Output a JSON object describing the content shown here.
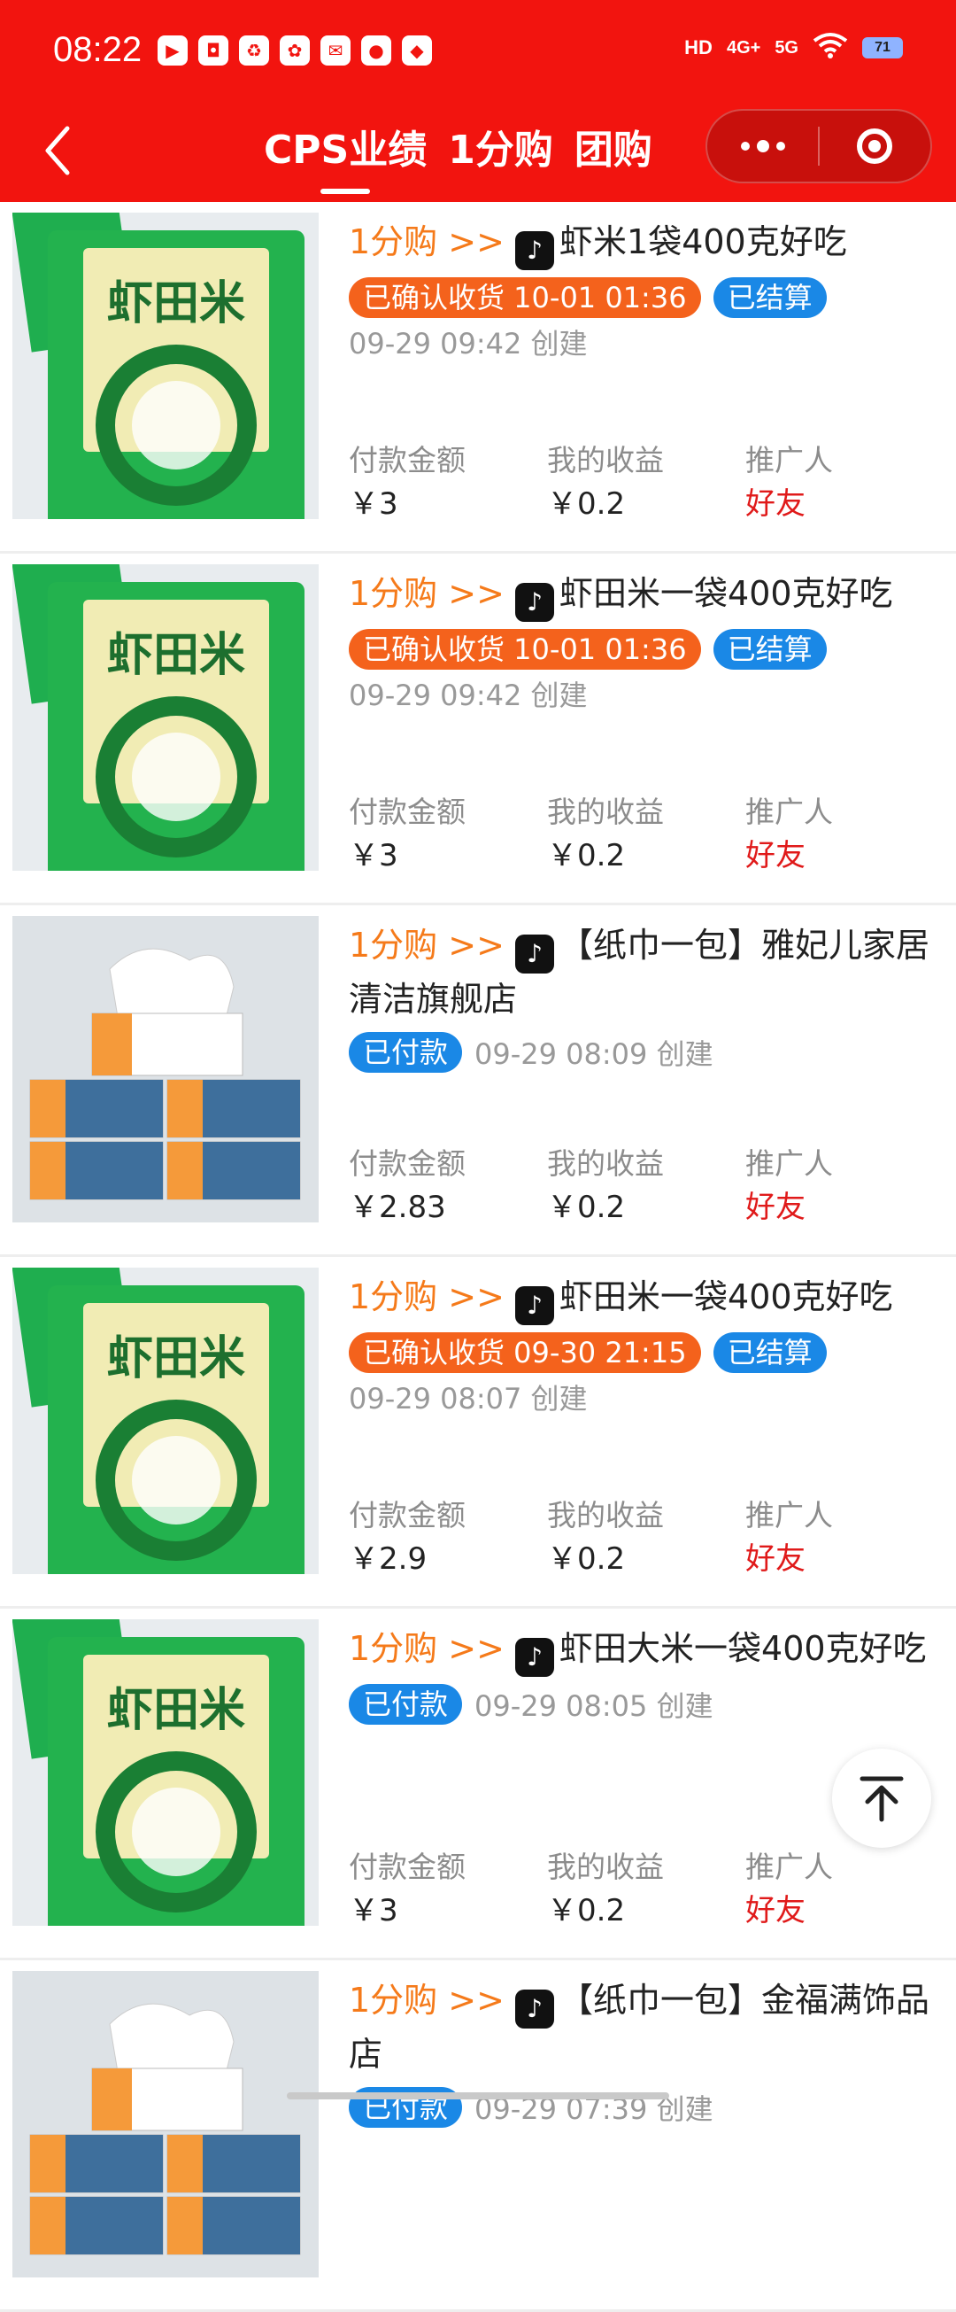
{
  "status_bar": {
    "time": "08:22",
    "network": [
      "HD",
      "4G+",
      "5G"
    ],
    "battery": "71"
  },
  "nav": {
    "tabs": [
      {
        "label": "CPS业绩",
        "active": true
      },
      {
        "label": "1分购",
        "active": false
      },
      {
        "label": "团购",
        "active": false
      }
    ]
  },
  "labels": {
    "paid": "付款金额",
    "earn": "我的收益",
    "promoter": "推广人",
    "created_suffix": "创建"
  },
  "orders": [
    {
      "prefix": "1分购 >>",
      "title": "虾米1袋400克好吃",
      "status": "已确认收货 10-01 01:36",
      "status_color": "orange",
      "settle": "已结算",
      "created": "09-29 09:42 创建",
      "paid": "￥3",
      "earn": "￥0.2",
      "promoter": "好友",
      "image": "rice-bag"
    },
    {
      "prefix": "1分购 >>",
      "title": "虾田米一袋400克好吃",
      "status": "已确认收货 10-01 01:36",
      "status_color": "orange",
      "settle": "已结算",
      "created": "09-29 09:42 创建",
      "paid": "￥3",
      "earn": "￥0.2",
      "promoter": "好友",
      "image": "rice-bag"
    },
    {
      "prefix": "1分购 >>",
      "title": "【纸巾一包】雅妃儿家居清洁旗舰店",
      "status": "已付款",
      "status_color": "blue",
      "settle": "",
      "created": "09-29 08:09 创建",
      "paid": "￥2.83",
      "earn": "￥0.2",
      "promoter": "好友",
      "image": "tissue"
    },
    {
      "prefix": "1分购 >>",
      "title": "虾田米一袋400克好吃",
      "status": "已确认收货 09-30 21:15",
      "status_color": "orange",
      "settle": "已结算",
      "created": "09-29 08:07 创建",
      "paid": "￥2.9",
      "earn": "￥0.2",
      "promoter": "好友",
      "image": "rice-bag"
    },
    {
      "prefix": "1分购 >>",
      "title": "虾田大米一袋400克好吃",
      "status": "已付款",
      "status_color": "blue",
      "settle": "",
      "created": "09-29 08:05 创建",
      "paid": "￥3",
      "earn": "￥0.2",
      "promoter": "好友",
      "image": "rice-bag"
    },
    {
      "prefix": "1分购 >>",
      "title": "【纸巾一包】金福满饰品店",
      "status": "已付款",
      "status_color": "blue",
      "settle": "",
      "created": "09-29 07:39 创建",
      "paid": "",
      "earn": "",
      "promoter": "",
      "image": "tissue"
    }
  ],
  "colors": {
    "header": "#f2140f",
    "prefix": "#f57a1a",
    "badge_orange": "#f4621c",
    "badge_blue": "#1a88e6",
    "promoter": "#e01a1a"
  }
}
